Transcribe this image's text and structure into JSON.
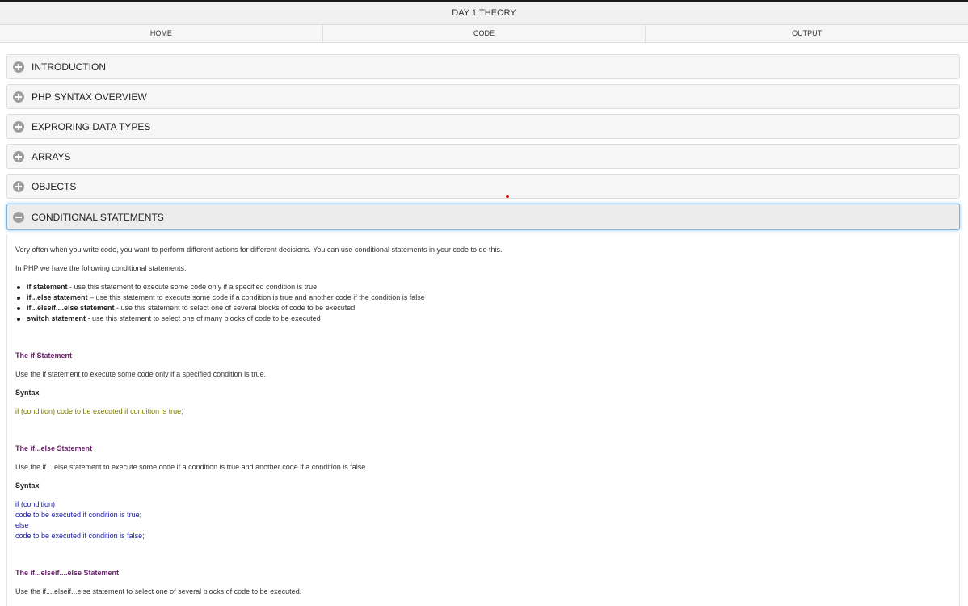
{
  "window": {
    "title": "DAY 1:THEORY"
  },
  "nav": {
    "items": [
      "HOME",
      "CODE",
      "OUTPUT"
    ]
  },
  "accordion": {
    "sections": [
      {
        "label": "INTRODUCTION",
        "icon": "plus-circle-icon"
      },
      {
        "label": "PHP SYNTAX OVERVIEW",
        "icon": "plus-circle-icon"
      },
      {
        "label": "EXPRORING DATA TYPES",
        "icon": "plus-circle-icon"
      },
      {
        "label": "ARRAYS",
        "icon": "plus-circle-icon"
      },
      {
        "label": "OBJECTS",
        "icon": "plus-circle-icon"
      },
      {
        "label": "CONDITIONAL STATEMENTS",
        "icon": "minus-circle-icon",
        "expanded": true
      }
    ]
  },
  "content": {
    "intro": "Very often when you write code, you want to perform different actions for different decisions. You can use conditional statements in your code to do this.",
    "intro2": "In PHP we have the following conditional statements:",
    "bullets": [
      {
        "term": "if statement",
        "desc": " - use this statement to execute some code only if a specified condition is true"
      },
      {
        "term": "if...else statement",
        "desc": " – use this statement to execute some code if a condition is true and another code if the condition is false"
      },
      {
        "term": "if...elseif....else statement",
        "desc": " - use this statement to select one of several blocks of code to be executed"
      },
      {
        "term": "switch statement",
        "desc": " - use this statement to select one of many blocks of code to be executed"
      }
    ],
    "if": {
      "heading": "The if Statement",
      "text": "Use the if statement to execute some code only if a specified condition is true.",
      "syntax_label": "Syntax",
      "code": "if (condition) code to be executed if condition is true;"
    },
    "ifelse": {
      "heading": "The if...else Statement",
      "text": "Use the if....else statement to execute some code if a condition is true and another code if a condition is false.",
      "syntax_label": "Syntax",
      "code": [
        "if (condition)",
        "code to be executed if condition is true;",
        "else",
        "code to be executed if condition is false;"
      ]
    },
    "ifelseif": {
      "heading": "The if...elseif....else Statement",
      "text": "Use the if....elseif...else statement to select one of several blocks of code to be executed."
    }
  },
  "colors": {
    "heading": "#6b1f6b",
    "code_olive": "#7a7a00",
    "code_blue": "#1a1aa6",
    "active_border": "#7eb3e0"
  }
}
